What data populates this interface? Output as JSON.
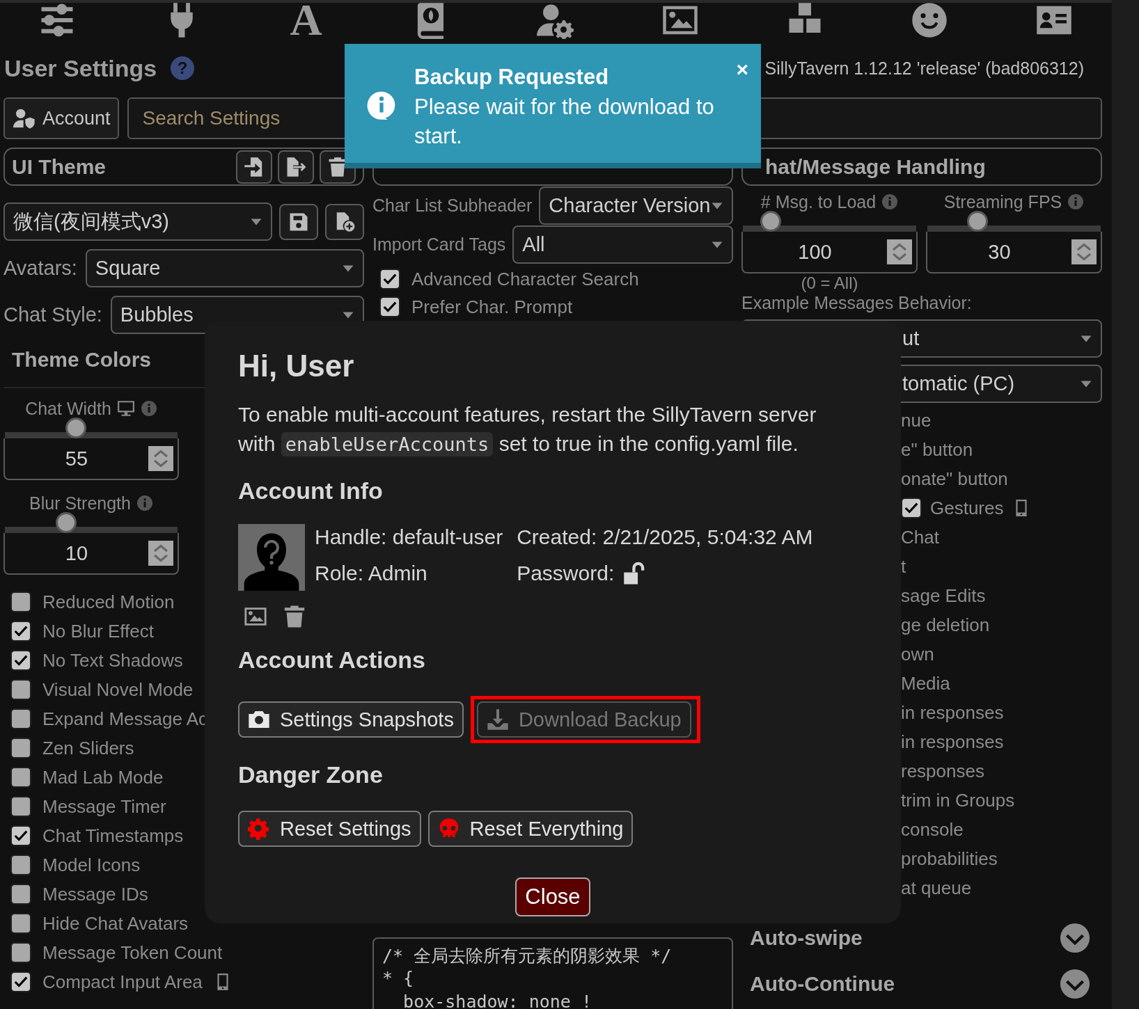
{
  "top_icons": [
    {
      "kind": "sliders"
    },
    {
      "kind": "plug"
    },
    {
      "kind": "glyph",
      "glyph": "A"
    },
    {
      "kind": "book"
    },
    {
      "kind": "user-gear"
    },
    {
      "kind": "image"
    },
    {
      "kind": "cubes"
    },
    {
      "kind": "smiley"
    },
    {
      "kind": "id-card"
    }
  ],
  "header": {
    "title": "User Settings",
    "help": "?",
    "version": "SillyTavern 1.12.12 'release' (bad806312)"
  },
  "account_button": "Account",
  "search": {
    "placeholder": "Search Settings"
  },
  "ui_theme": {
    "title": "UI Theme",
    "theme": "微信(夜间模式v3)",
    "avatars_label": "Avatars:",
    "avatars": "Square",
    "chat_style_label": "Chat Style:",
    "chat_style": "Bubbles"
  },
  "theme_colors": "Theme Colors",
  "left_sliders": [
    {
      "label": "Chat Width",
      "kind": "desktop",
      "level": 0.41,
      "value": "55"
    },
    {
      "label": "Blur Strength",
      "level": 0.355,
      "value": "10"
    }
  ],
  "display_options": [
    {
      "label": "Reduced Motion",
      "checked": false
    },
    {
      "label": "No Blur Effect",
      "checked": true
    },
    {
      "label": "No Text Shadows",
      "checked": true
    },
    {
      "label": "Visual Novel Mode",
      "checked": false
    },
    {
      "label": "Expand Message Ac",
      "checked": false
    },
    {
      "label": "Zen Sliders",
      "checked": false
    },
    {
      "label": "Mad Lab Mode",
      "checked": false
    },
    {
      "label": "Message Timer",
      "checked": false
    },
    {
      "label": "Chat Timestamps",
      "checked": true
    },
    {
      "label": "Model Icons",
      "checked": false
    },
    {
      "label": "Message IDs",
      "checked": false
    },
    {
      "label": "Hide Chat Avatars",
      "checked": false
    },
    {
      "label": "Message Token Count",
      "checked": false
    },
    {
      "label": "Compact Input Area",
      "checked": true,
      "kind": "mobile"
    }
  ],
  "character_handling": {
    "rows": [
      {
        "label": "Char List Subheader",
        "value": "Character Version"
      },
      {
        "label": "Import Card Tags",
        "value": "All"
      }
    ],
    "checks": [
      {
        "label": "Advanced Character Search",
        "checked": true
      },
      {
        "label": "Prefer Char. Prompt",
        "checked": true
      }
    ]
  },
  "custom_css": [
    "/* 全局去除所有元素的阴影效果 */",
    "* {",
    "  box-shadow: none !"
  ],
  "chat_handling": {
    "title": "hat/Message Handling",
    "sliders": [
      {
        "label": "# Msg. to Load",
        "level": 0.16,
        "value": "100",
        "note": "(0 = All)"
      },
      {
        "label": "Streaming FPS",
        "level": 0.29,
        "value": "30"
      }
    ],
    "example_label": "Example Messages Behavior:",
    "selects": [
      "ut",
      "tomatic (PC)"
    ],
    "options": [
      {
        "label": "nue"
      },
      {
        "label": "e\" button"
      },
      {
        "label": "onate\" button"
      },
      {
        "label": "Gestures",
        "checked": true,
        "kind": "mobile"
      },
      {
        "label": "Chat"
      },
      {
        "label": "t"
      },
      {
        "label": "sage Edits"
      },
      {
        "label": "ge deletion"
      },
      {
        "label": "own"
      },
      {
        "label": "Media"
      },
      {
        "label": "in responses"
      },
      {
        "label": "in responses"
      },
      {
        "label": "responses"
      },
      {
        "label": "trim in Groups"
      },
      {
        "label": "console"
      },
      {
        "label": "probabilities"
      },
      {
        "label": "at queue"
      }
    ]
  },
  "sections": [
    {
      "title": "Auto-swipe",
      "expanded": false
    },
    {
      "title": "Auto-Continue",
      "expanded": false
    }
  ],
  "modal": {
    "title": "Hi, User",
    "intro_before": "To enable multi-account features, restart the SillyTavern server with",
    "intro_code": "enableUserAccounts",
    "intro_after": "set to true in the config.yaml file.",
    "info_title": "Account Info",
    "handle": "Handle: default-user",
    "created": "Created: 2/21/2025, 5:04:32 AM",
    "role": "Role: Admin",
    "password": "Password:",
    "actions_title": "Account Actions",
    "actions": [
      {
        "label": "Settings Snapshots",
        "kind": "camera",
        "disabled": false,
        "highlighted": false
      },
      {
        "label": "Download Backup",
        "kind": "download",
        "disabled": true,
        "highlighted": true
      }
    ],
    "danger_title": "Danger Zone",
    "danger": [
      {
        "label": "Reset Settings",
        "kind": "gear"
      },
      {
        "label": "Reset Everything",
        "kind": "skull"
      }
    ],
    "close": "Close"
  },
  "toast": {
    "title": "Backup Requested",
    "message": "Please wait for the download to start.",
    "close": "×"
  }
}
